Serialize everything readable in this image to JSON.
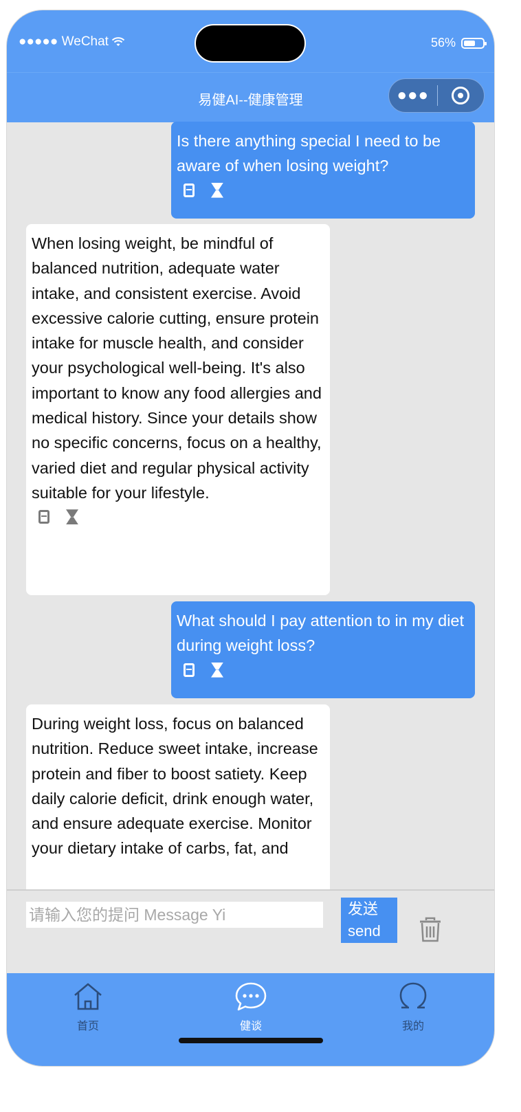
{
  "status": {
    "carrier": "●●●●● WeChat",
    "battery": "56%"
  },
  "nav": {
    "title": "易健AI--健康管理"
  },
  "messages": [
    {
      "role": "user",
      "text": "Is there anything special I need to be aware of when losing weight?"
    },
    {
      "role": "ai",
      "text": "When losing weight, be mindful of balanced nutrition, adequate water intake, and consistent exercise. Avoid excessive calorie cutting, ensure protein intake for muscle health, and consider your psychological well-being. It's also important to know any food allergies and medical history. Since your details show no specific concerns, focus on a healthy, varied diet and regular physical activity suitable for your lifestyle."
    },
    {
      "role": "user",
      "text": "What should I pay attention to in my diet during weight loss?"
    },
    {
      "role": "ai",
      "text": "During weight loss, focus on balanced nutrition. Reduce sweet intake, increase protein and fiber to boost satiety. Keep daily calorie deficit, drink enough water, and ensure adequate exercise. Monitor your dietary intake of carbs, fat, and"
    }
  ],
  "input": {
    "placeholder": "请输入您的提问 Message Yi",
    "value": ""
  },
  "send": {
    "line1": "发送",
    "line2": "send"
  },
  "tabs": [
    {
      "label": "首页",
      "icon": "home-icon"
    },
    {
      "label": "健谈",
      "icon": "chat-bubble-icon"
    },
    {
      "label": "我的",
      "icon": "profile-icon"
    }
  ],
  "colors": {
    "accent": "#5a9df5",
    "user_bubble": "#4790f1",
    "background": "#e6e6e6",
    "tab_inactive": "#2c4d7c"
  }
}
